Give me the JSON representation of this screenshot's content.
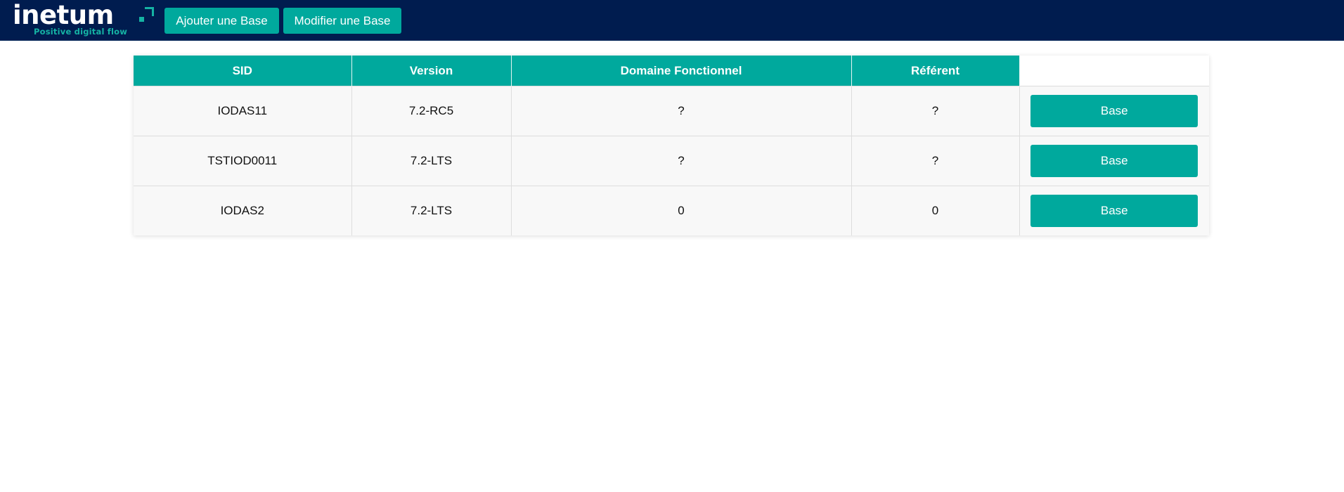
{
  "header": {
    "logo": {
      "word": "inetum",
      "tagline": "Positive digital flow",
      "accent_color": "#15b3a4"
    },
    "background_color": "#001c4f",
    "buttons": {
      "add_label": "Ajouter une Base",
      "edit_label": "Modifier une Base"
    }
  },
  "table": {
    "header_color": "#00a99d",
    "columns": [
      "SID",
      "Version",
      "Domaine Fonctionnel",
      "Référent",
      ""
    ],
    "rows": [
      {
        "sid": "IODAS11",
        "version": "7.2-RC5",
        "domaine": "?",
        "referent": "?",
        "action_label": "Base"
      },
      {
        "sid": "TSTIOD0011",
        "version": "7.2-LTS",
        "domaine": "?",
        "referent": "?",
        "action_label": "Base"
      },
      {
        "sid": "IODAS2",
        "version": "7.2-LTS",
        "domaine": "0",
        "referent": "0",
        "action_label": "Base"
      }
    ]
  }
}
